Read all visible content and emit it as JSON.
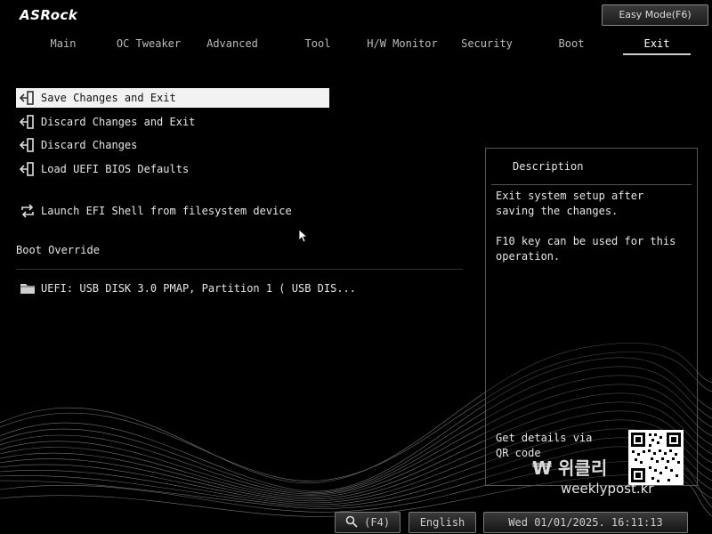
{
  "brand": "ASRock",
  "easy_mode_label": "Easy Mode(F6)",
  "tabs": [
    {
      "label": "Main",
      "active": false
    },
    {
      "label": "OC Tweaker",
      "active": false
    },
    {
      "label": "Advanced",
      "active": false
    },
    {
      "label": "Tool",
      "active": false
    },
    {
      "label": "H/W Monitor",
      "active": false
    },
    {
      "label": "Security",
      "active": false
    },
    {
      "label": "Boot",
      "active": false
    },
    {
      "label": "Exit",
      "active": true
    }
  ],
  "menu": [
    {
      "label": "Save Changes and Exit",
      "icon": "exit-icon",
      "selected": true
    },
    {
      "label": "Discard Changes and Exit",
      "icon": "exit-icon",
      "selected": false
    },
    {
      "label": "Discard Changes",
      "icon": "exit-icon",
      "selected": false
    },
    {
      "label": "Load UEFI BIOS Defaults",
      "icon": "exit-icon",
      "selected": false
    },
    {
      "label": "Launch EFI Shell from filesystem device",
      "icon": "refresh-icon",
      "selected": false
    }
  ],
  "boot_override": {
    "label": "Boot Override",
    "items": [
      {
        "label": "UEFI:  USB DISK 3.0 PMAP, Partition 1 ( USB DIS...",
        "icon": "folder-icon"
      }
    ]
  },
  "description": {
    "title": "Description",
    "text": "Exit system setup after saving the changes.\n\nF10 key can be used for this operation.",
    "qr_text": "Get details via QR code"
  },
  "watermark": {
    "main": "위클리",
    "url": "weeklypost.kr"
  },
  "bottom_bar": {
    "search_label": "(F4)",
    "language": "English",
    "datetime": "Wed 01/01/2025. 16:11:13"
  },
  "colors": {
    "background": "#000000",
    "selected_row": "#f2f2f2",
    "text": "#e6e6e6"
  }
}
